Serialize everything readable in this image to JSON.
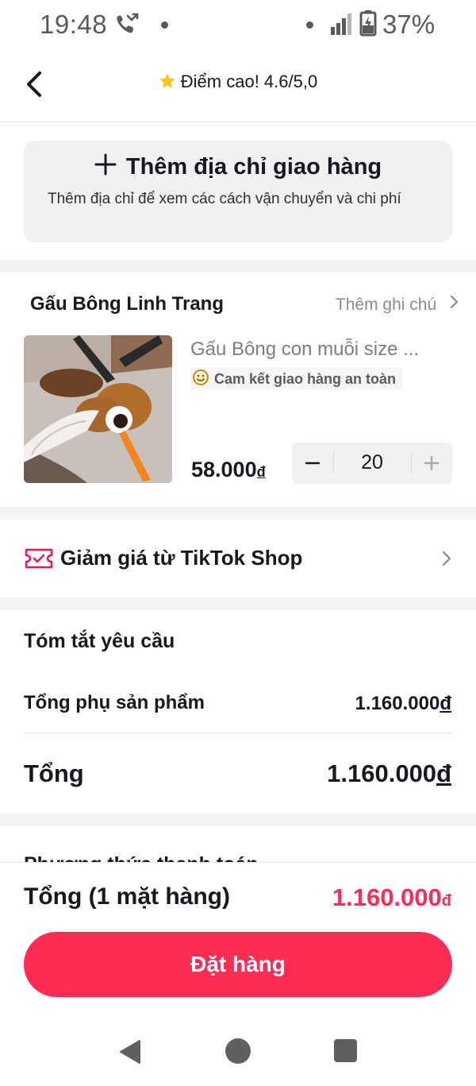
{
  "status_bar": {
    "time": "19:48",
    "battery_percent": "37%",
    "icons": [
      "call-forward-icon",
      "notification-dot",
      "signal-icon",
      "battery-charging-icon"
    ]
  },
  "header": {
    "back_icon": "chevron-left-icon",
    "rating_icon": "star-icon",
    "rating_text": "Điểm cao! 4.6/5,0"
  },
  "address": {
    "title": "Thêm địa chỉ giao hàng",
    "description": "Thêm địa chỉ để xem các cách vận chuyển và chi phí"
  },
  "shop": {
    "name": "Gấu Bông Linh Trang",
    "add_note": "Thêm ghi chú"
  },
  "product": {
    "name": "Gấu Bông con muỗi size ...",
    "badge": "Cam kết giao hàng an toàn",
    "price": "58.000",
    "currency": "đ",
    "quantity": "20"
  },
  "discount": {
    "label": "Giảm giá từ TikTok Shop",
    "icon": "voucher-icon"
  },
  "summary": {
    "title": "Tóm tắt yêu cầu",
    "subtotal_label": "Tổng phụ sản phẩm",
    "subtotal_value": "1.160.000",
    "total_label": "Tổng",
    "total_value": "1.160.000",
    "currency": "đ"
  },
  "payment_peek": "Phương thức thanh toán",
  "footer": {
    "total_label": "Tổng (1 mặt hàng)",
    "total_value": "1.160.000",
    "currency": "đ",
    "order_button": "Đặt hàng"
  },
  "colors": {
    "accent": "#fe2c55",
    "text": "#161823",
    "muted": "#8a8b91",
    "card_bg": "#f1f1f2",
    "gold_star": "#fcc419"
  },
  "nav_bar": [
    "back-triangle-icon",
    "home-circle-icon",
    "recents-square-icon"
  ]
}
